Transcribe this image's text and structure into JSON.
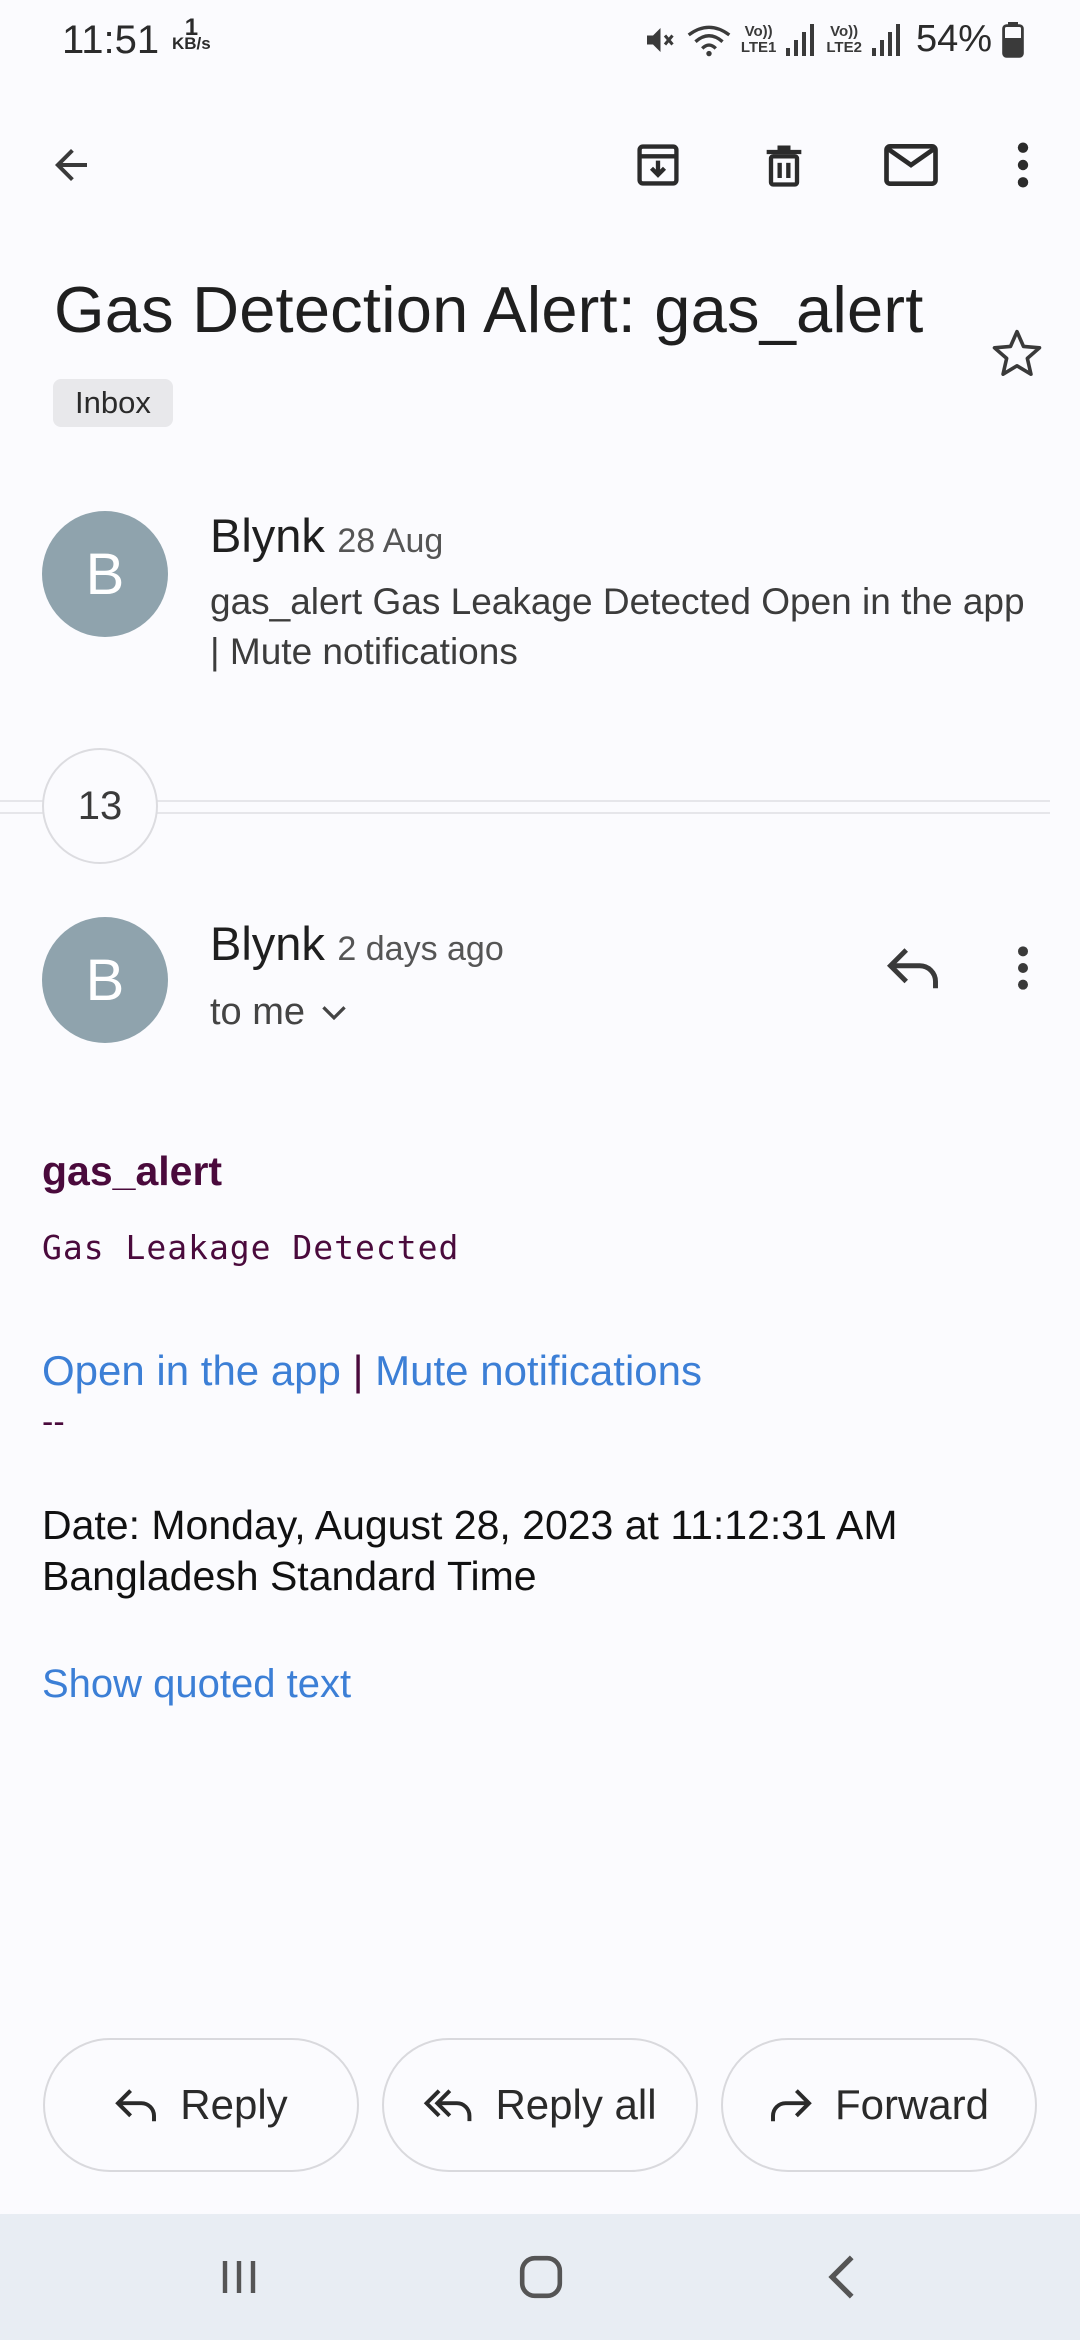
{
  "status": {
    "time": "11:51",
    "speed_value": "1",
    "speed_unit": "KB/s",
    "sim1_label_top": "Vo))",
    "sim1_label_bottom": "LTE1",
    "sim2_label_top": "Vo))",
    "sim2_label_bottom": "LTE2",
    "battery": "54%",
    "icons": [
      "mute-icon",
      "wifi-icon",
      "signal-icon",
      "battery-icon"
    ]
  },
  "toolbar": {
    "icons": [
      "back-arrow-icon",
      "archive-icon",
      "delete-icon",
      "mark-unread-icon",
      "more-vert-icon"
    ]
  },
  "email": {
    "subject": "Gas Detection Alert: gas_alert",
    "label": "Inbox",
    "collapsed_message": {
      "avatar_letter": "B",
      "sender": "Blynk",
      "date": "28 Aug",
      "snippet": "gas_alert Gas Leakage Detected Open in the app | Mute notifications"
    },
    "hidden_count": "13",
    "expanded_message": {
      "avatar_letter": "B",
      "sender": "Blynk",
      "date": "2 days ago",
      "recipient": "to me",
      "body_title": "gas_alert",
      "body_text": "Gas Leakage Detected",
      "link_open_app": "Open in the app",
      "link_separator": "|",
      "link_mute": "Mute notifications",
      "signature_dash": "--",
      "date_line": "Date: Monday, August 28, 2023 at 11:12:31 AM Bangladesh Standard Time",
      "show_quoted": "Show quoted text"
    }
  },
  "actions": {
    "reply": "Reply",
    "reply_all": "Reply all",
    "forward": "Forward"
  },
  "colors": {
    "background": "#fbfbfe",
    "avatar": "#8fa3ad",
    "link": "#3c7fd6",
    "body_text": "#4a0a3c",
    "nav_bar": "#e8edf3"
  }
}
